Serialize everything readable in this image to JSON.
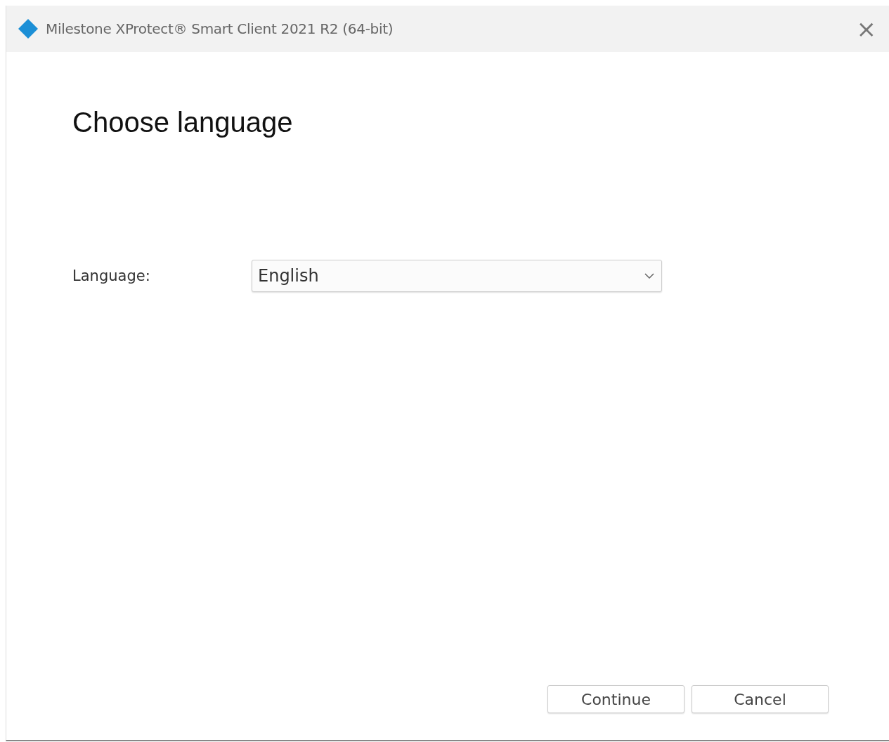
{
  "window": {
    "title": "Milestone XProtect® Smart Client 2021 R2 (64-bit)",
    "close": "×"
  },
  "heading": "Choose language",
  "language": {
    "label": "Language:",
    "value": "English"
  },
  "buttons": [
    {
      "label": "Continue"
    },
    {
      "label": "Cancel"
    }
  ]
}
